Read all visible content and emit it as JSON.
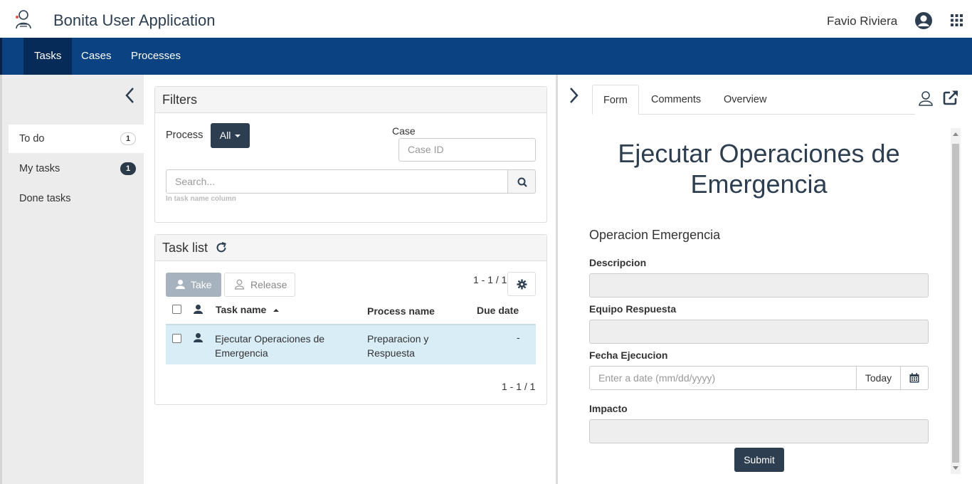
{
  "header": {
    "app_title": "Bonita User Application",
    "user_name": "Favio Riviera"
  },
  "nav": {
    "items": [
      {
        "label": "Tasks",
        "active": true
      },
      {
        "label": "Cases",
        "active": false
      },
      {
        "label": "Processes",
        "active": false
      }
    ]
  },
  "sidebar": {
    "items": [
      {
        "label": "To do",
        "count": "1",
        "active": true
      },
      {
        "label": "My tasks",
        "count": "1",
        "active": false
      },
      {
        "label": "Done tasks",
        "count": "",
        "active": false
      }
    ]
  },
  "filters": {
    "title": "Filters",
    "process_label": "Process",
    "process_value": "All",
    "case_label": "Case",
    "case_placeholder": "Case ID",
    "search_placeholder": "Search...",
    "search_hint": "In task name column"
  },
  "task_list": {
    "title": "Task list",
    "take_label": "Take",
    "release_label": "Release",
    "pagination_top": "1 - 1 / 1",
    "pagination_bottom": "1 - 1 / 1",
    "columns": {
      "task_name": "Task name",
      "process_name": "Process name",
      "due_date": "Due date"
    },
    "rows": [
      {
        "task_name_line1": "Ejecutar Operaciones de",
        "task_name_line2": "Emergencia",
        "process_line1": "Preparacion y",
        "process_line2": "Respuesta",
        "due_date": "-"
      }
    ]
  },
  "detail": {
    "tabs": [
      "Form",
      "Comments",
      "Overview"
    ],
    "active_tab": "Form",
    "form_title": "Ejecutar Operaciones de Emergencia",
    "form_subtitle": "Operacion Emergencia",
    "fields": {
      "descripcion": "Descripcion",
      "equipo": "Equipo Respuesta",
      "fecha": "Fecha Ejecucion",
      "fecha_placeholder": "Enter a date (mm/dd/yyyy)",
      "today_label": "Today",
      "impacto": "Impacto"
    },
    "submit_label": "Submit"
  },
  "colors": {
    "navbar": "#0b4282",
    "navbar_active": "#072b59",
    "dark_button": "#2c3e50",
    "selected_row": "#d9edf7"
  }
}
